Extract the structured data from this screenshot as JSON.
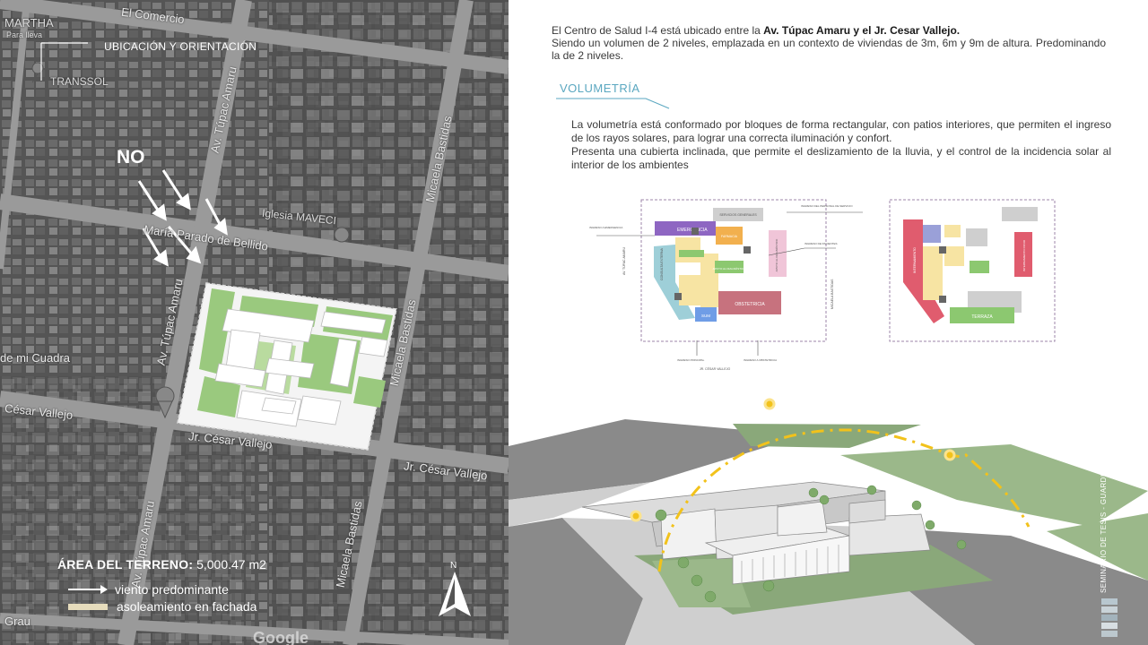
{
  "map": {
    "title": "UBICACIÓN Y ORIENTACIÓN",
    "wind_label": "NO",
    "area_label": "ÁREA DEL TERRENO:",
    "area_value": "5,000.47 m2",
    "legend_wind": "viento predominante",
    "legend_sun": "asoleamiento en fachada",
    "north_label": "N",
    "google_logo": "Google",
    "streets": {
      "comercio": "El Comercio",
      "tupac_top": "Av. Túpac Amaru",
      "tupac_mid": "Av. Túpac Amaru",
      "tupac_bottom": "Av. Túpac Amaru",
      "bastidas_top": "Micaela Bastidas",
      "bastidas_mid": "Micaela Bastidas",
      "bastidas_bottom": "Micaela Bastidas",
      "bellido": "María Parado de Bellido",
      "vallejo_left": "César Vallejo",
      "vallejo_mid": "Jr. César Vallejo",
      "vallejo_right": "Jr. César Vallejo",
      "grau": "Grau",
      "mi_cuadra": "de mi Cuadra"
    },
    "places": {
      "martha": "MARTHA",
      "martha_sub": "Para lleva",
      "transsol": "TRANSSOL",
      "maveci": "Iglesia MAVECI"
    }
  },
  "intro": {
    "text_a": "El Centro de Salud I-4 está ubicado entre la ",
    "text_bold": "Av. Túpac Amaru y el Jr. Cesar Vallejo.",
    "text_b": "Siendo un volumen de 2 niveles, emplazada en un contexto de viviendas de 3m, 6m y 9m de altura. Predominando la de 2 niveles."
  },
  "volumetria": {
    "title": "VOLUMETRÍA",
    "p1": "La volumetría está conformado por bloques de forma rectangular, con patios interiores, que permiten el ingreso de los rayos solares, para lograr una correcta iluminación y confort.",
    "p2": "Presenta una cubierta inclinada, que permite el deslizamiento de la lluvia, y el control de la incidencia solar al interior de los ambientes"
  },
  "plan1": {
    "emergencia": "EMERGENCIA",
    "obstetricia": "OBSTETRICIA",
    "sum": "SUM",
    "consulta_externa": "CONSULTA EXTERNA",
    "farmacia": "FARMACIA",
    "apoyo_diagnostico": "APOYO AL DIAGNÓSTICO",
    "servicios_generales": "SERVICIOS GENERALES",
    "ingreso_emergencia": "INGRESO A EMERGENCIA",
    "ingreso_personal": "INGRESO DEL PERSONAL DE SERVICIO",
    "ingreso_pacientes": "INGRESO DE PACIENTES",
    "ingreso_principal": "INGRESO PRINCIPAL",
    "ingreso_obstetricia": "INGRESO A OBSTETRICIA",
    "av_tupac": "AV. TÚPAC AMARU",
    "micaela": "MICAELA BASTIDAS",
    "jr_vallejo": "JR. CÉSAR VALLEJO"
  },
  "plan2": {
    "internamiento": "INTERNAMIENTO",
    "internamiento_covid": "INTERNAMIENTO COVID",
    "terraza": "TERRAZA"
  },
  "side_caption": "SEMINARIO DE TESIS - GUARDIA",
  "colors": {
    "accent": "#5aa7c0",
    "sun": "#f2c21b",
    "green": "#8cc870",
    "purple_border": "#9c86a8"
  }
}
